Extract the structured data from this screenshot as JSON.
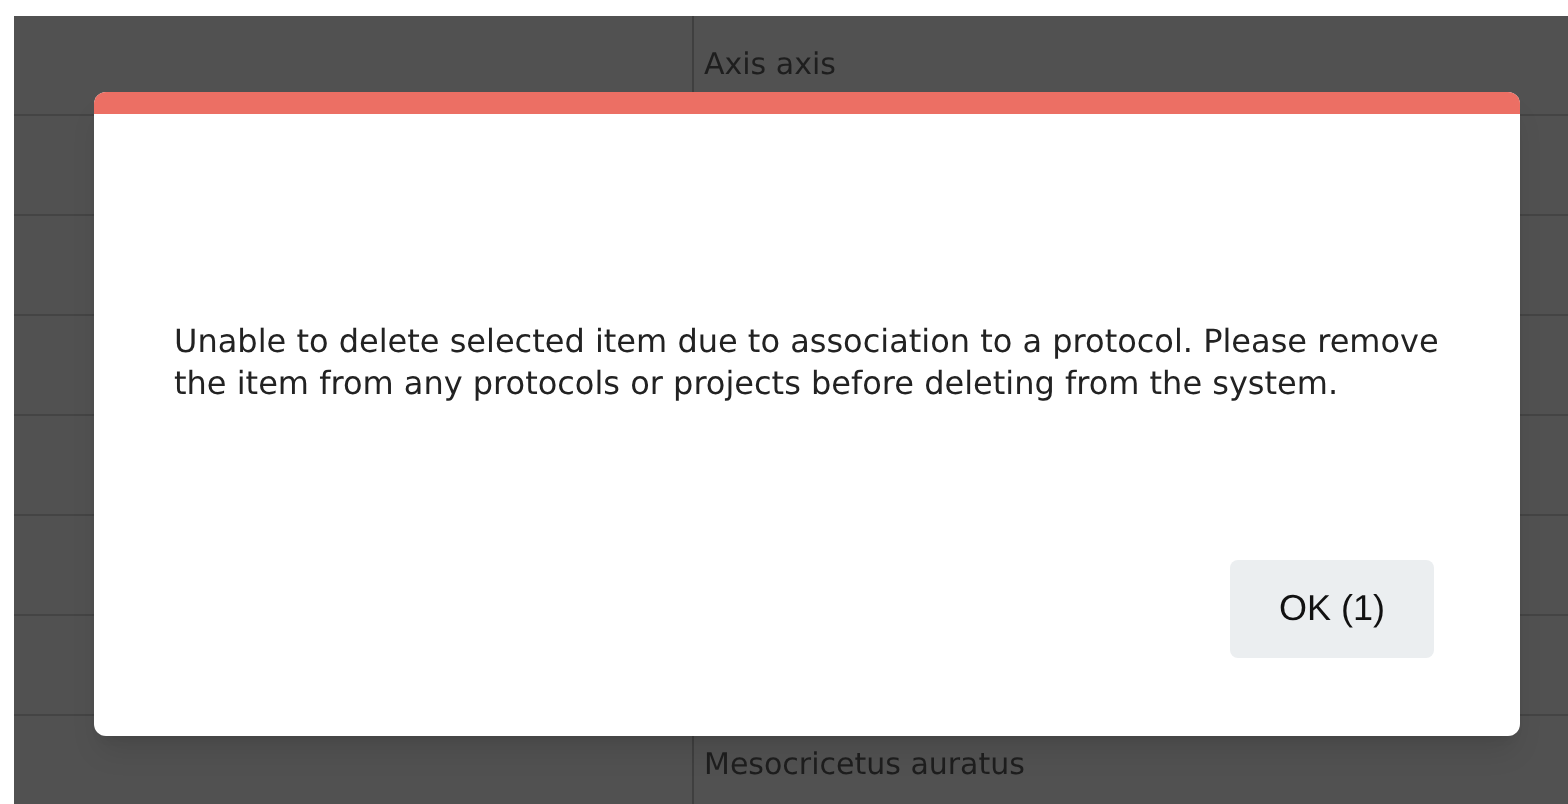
{
  "table": {
    "rows": [
      {
        "column_2": "Axis axis"
      },
      {},
      {},
      {},
      {},
      {},
      {},
      {
        "column_2": "Mesocricetus auratus"
      }
    ]
  },
  "dialog": {
    "message": "Unable to delete selected item due to association to a protocol. Please remove the item from any protocols or projects before deleting from the system.",
    "buttons": [
      "OK (1)"
    ]
  }
}
